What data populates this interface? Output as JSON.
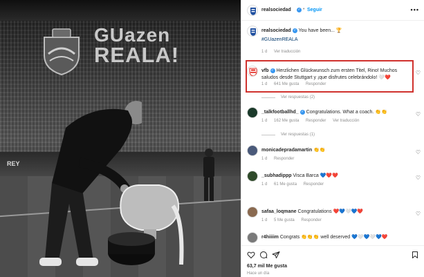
{
  "photo": {
    "banner_line1": "GUazen",
    "banner_line2": "REALA!",
    "board_text": "REY"
  },
  "header": {
    "username": "realsociedad",
    "follow_label": "Seguir",
    "more_label": "•••"
  },
  "caption": {
    "username": "realsociedad",
    "text": "You have been...",
    "emoji": "🏆",
    "hashtag": "#GUazenREALA",
    "time": "1 d",
    "translate": "Ver traducción"
  },
  "comments": [
    {
      "username": "vfb",
      "text": "Herzlichen Glückwunsch zum ersten Titel, Rino! Muchos saludos desde Stuttgart y ¡que disfrutes celebrándolo!",
      "emoji": "🤍❤️",
      "time": "1 d",
      "likes": "641 Me gusta",
      "reply": "Responder",
      "replies": "Ver respuestas (2)",
      "translate": ""
    },
    {
      "username": "_talkfootballhd_",
      "text": "Congratulations. What a coach.",
      "emoji": "👏👏",
      "time": "1 d",
      "likes": "162 Me gusta",
      "reply": "Responder",
      "replies": "Ver respuestas (1)",
      "translate": "Ver traducción"
    },
    {
      "username": "monicadepradamartin",
      "text": "",
      "emoji": "👏👏",
      "time": "1 d",
      "likes": "",
      "reply": "Responder",
      "replies": "",
      "translate": ""
    },
    {
      "username": "_subhadippp",
      "text": "Visca Barca",
      "emoji": "💙❤️❤️",
      "time": "1 d",
      "likes": "61 Me gusta",
      "reply": "Responder",
      "replies": "",
      "translate": ""
    },
    {
      "username": "safaa_loqmane",
      "text": "Congratulations",
      "emoji": "❤️💙🤍💙❤️",
      "time": "1 d",
      "likes": "5 Me gusta",
      "reply": "Responder",
      "replies": "",
      "translate": ""
    },
    {
      "username": "r4hiiiim",
      "text": "Congrats",
      "emoji": "👏👏👏",
      "text2": "well deserved",
      "emoji2": "💙🤍💙🤍💙❤️",
      "time": "",
      "likes": "",
      "reply": "",
      "replies": "",
      "translate": ""
    }
  ],
  "footer": {
    "likes": "63,7 mil Me gusta",
    "ago": "Hace un día"
  },
  "colors": {
    "accent_blue": "#0095f6",
    "highlight_red": "#d0312d",
    "verified_blue": "#3897f0"
  }
}
